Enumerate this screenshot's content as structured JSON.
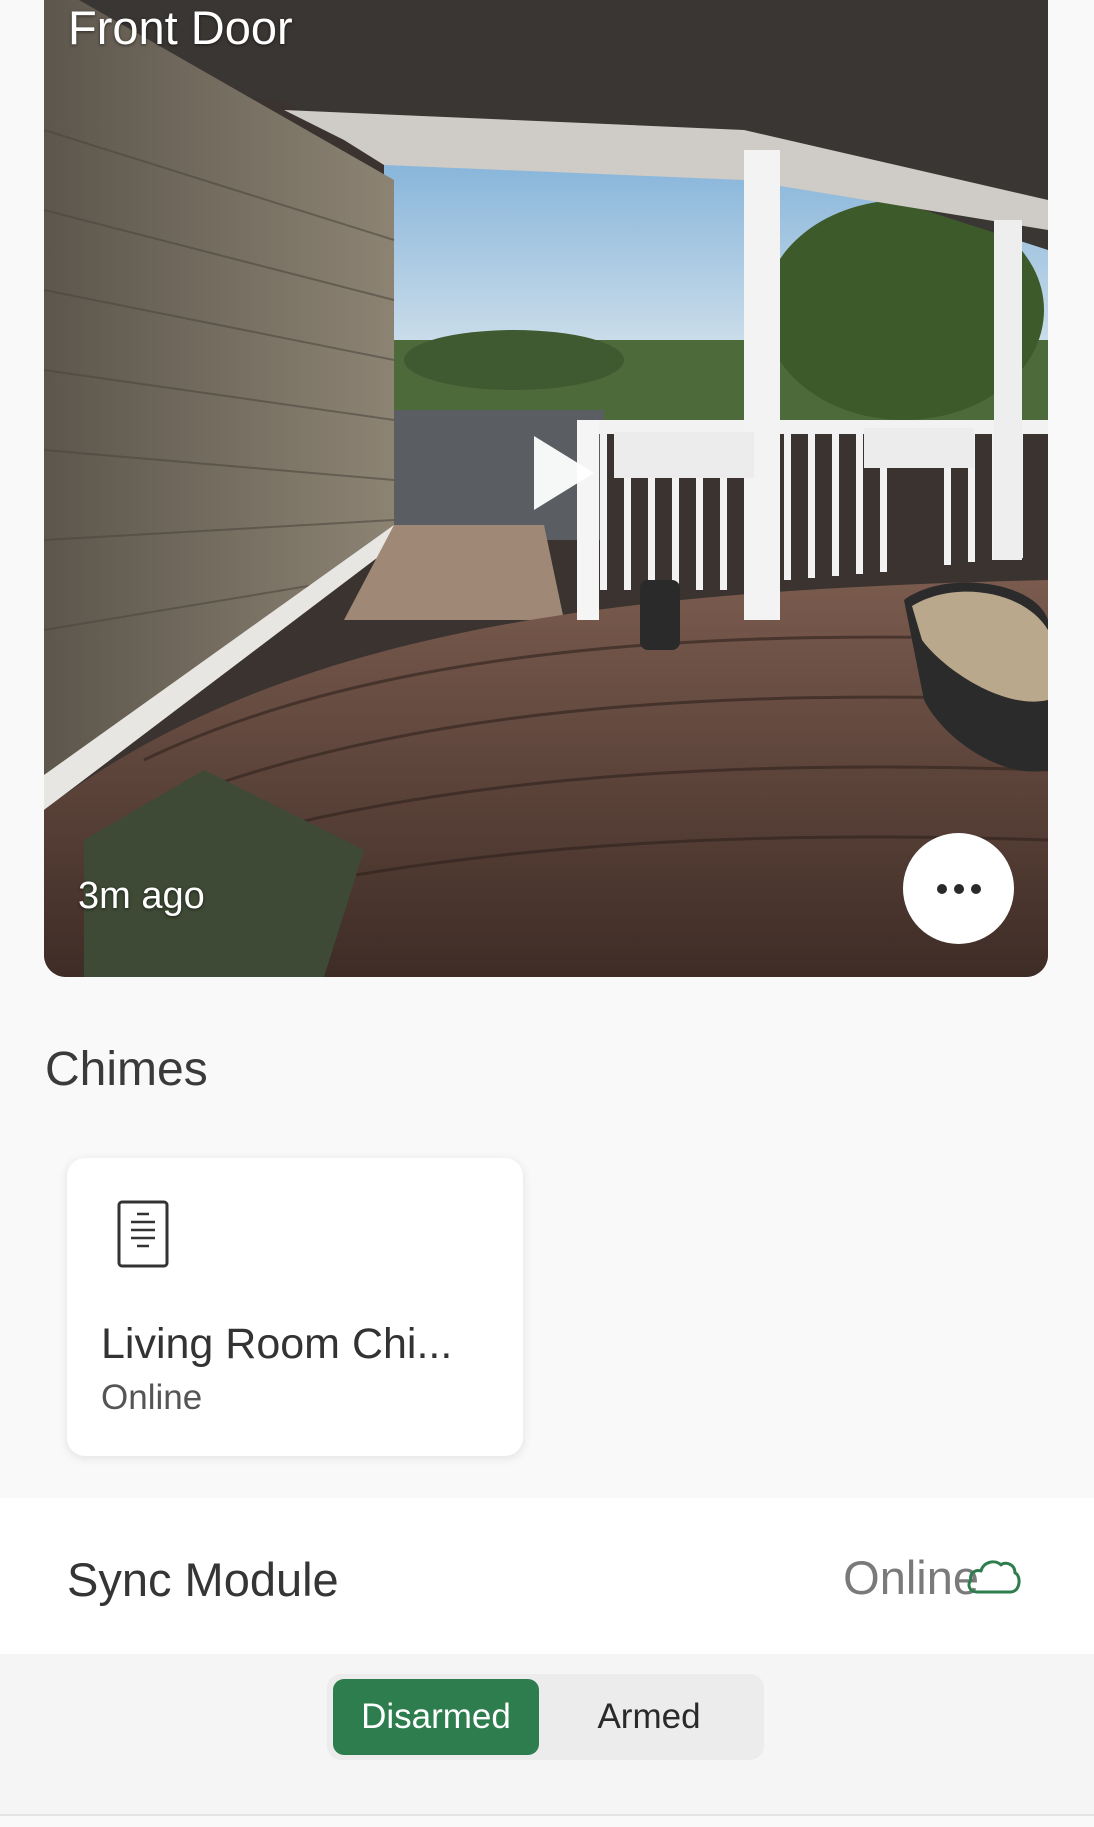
{
  "camera": {
    "title": "Front Door",
    "last_updated": "3m ago",
    "play_icon": "play-icon",
    "more_icon": "ellipsis-icon"
  },
  "chimes": {
    "heading": "Chimes",
    "items": [
      {
        "name": "Living Room Chi...",
        "status": "Online",
        "icon": "chime-device-icon"
      }
    ]
  },
  "sync_module": {
    "label": "Sync Module",
    "status": "Online",
    "status_icon": "cloud-icon",
    "status_color": "#2e7d4e"
  },
  "arm_toggle": {
    "options": [
      "Disarmed",
      "Armed"
    ],
    "selected": "Disarmed",
    "active_color": "#2e7d4e"
  }
}
